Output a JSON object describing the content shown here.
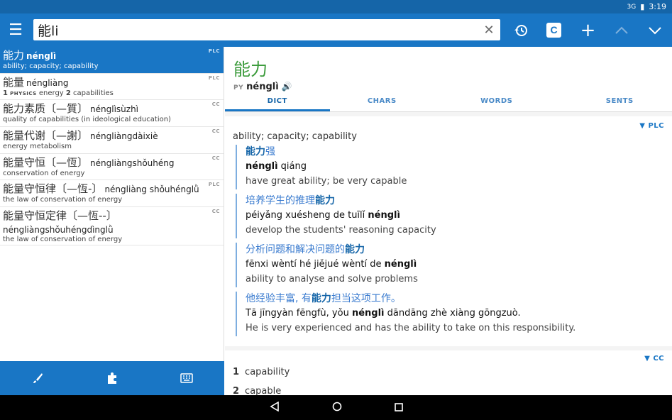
{
  "status": {
    "signal": "3G",
    "time": "3:19"
  },
  "toolbar": {
    "search_value": "能li",
    "c_label": "C"
  },
  "list": [
    {
      "hz": "能力",
      "py": "nénglì",
      "def": "ability; capacity; capability",
      "src": "PLC",
      "selected": true
    },
    {
      "hz": "能量",
      "py": "néngliàng",
      "def_n1": "1",
      "def_tag": "PHYSICS",
      "def_a": "energy",
      "def_n2": "2",
      "def_b": "capabilities",
      "src": "PLC"
    },
    {
      "hz": "能力素质",
      "alt": "〔—質〕",
      "py": "nénglìsùzhì",
      "def": "quality of capabilities (in ideological education)",
      "src": "CC"
    },
    {
      "hz": "能量代谢",
      "alt": "〔—謝〕",
      "py": "néngliàngdàixiè",
      "def": "energy metabolism",
      "src": "CC"
    },
    {
      "hz": "能量守恒",
      "alt": "〔—恆〕",
      "py": "néngliàngshǒuhéng",
      "def": "conservation of energy",
      "src": "CC"
    },
    {
      "hz": "能量守恒律",
      "alt": "〔—恆-〕",
      "py": "néngliàng shǒuhénglǜ",
      "def": "the law of conservation of energy",
      "src": "PLC"
    },
    {
      "hz": "能量守恒定律",
      "alt": "〔—恆--〕",
      "py": "néngliàngshǒuhéngdìnglǜ",
      "def": "the law of conservation of energy",
      "src": "CC"
    }
  ],
  "entry": {
    "word": "能力",
    "py_label": "PY",
    "py": "nénglì"
  },
  "tabs": [
    "DICT",
    "CHARS",
    "WORDS",
    "SENTS"
  ],
  "plc": {
    "src": "▼ PLC",
    "def": "ability; capacity; capability",
    "examples": [
      {
        "zh_pre": "",
        "zh_bold": "能力",
        "zh_post": "强",
        "py_pre": "",
        "py_bold": "nénglì",
        "py_post": " qiáng",
        "en": "have great ability; be very capable"
      },
      {
        "zh_pre": "培养学生的推理",
        "zh_bold": "能力",
        "zh_post": "",
        "py_pre": "péiyǎng xuésheng de tuīlǐ ",
        "py_bold": "nénglì",
        "py_post": "",
        "en": "develop the students' reasoning capacity"
      },
      {
        "zh_pre": "分析问题和解决问题的",
        "zh_bold": "能力",
        "zh_post": "",
        "py_pre": "fēnxi wèntí hé jiějué wèntí de ",
        "py_bold": "nénglì",
        "py_post": "",
        "en": "ability to analyse and solve problems"
      },
      {
        "zh_pre": "他经验丰富, 有",
        "zh_bold": "能力",
        "zh_post": "担当这项工作。",
        "py_pre": "Tā jīngyàn fēngfù, yǒu ",
        "py_bold": "nénglì",
        "py_post": " dāndāng zhè xiàng gōngzuò.",
        "en": "He is very experienced and has the ability to take on this responsibility."
      }
    ]
  },
  "cc": {
    "src": "▼ CC",
    "items": [
      {
        "n": "1",
        "t": "capability"
      },
      {
        "n": "2",
        "t": "capable"
      }
    ]
  }
}
